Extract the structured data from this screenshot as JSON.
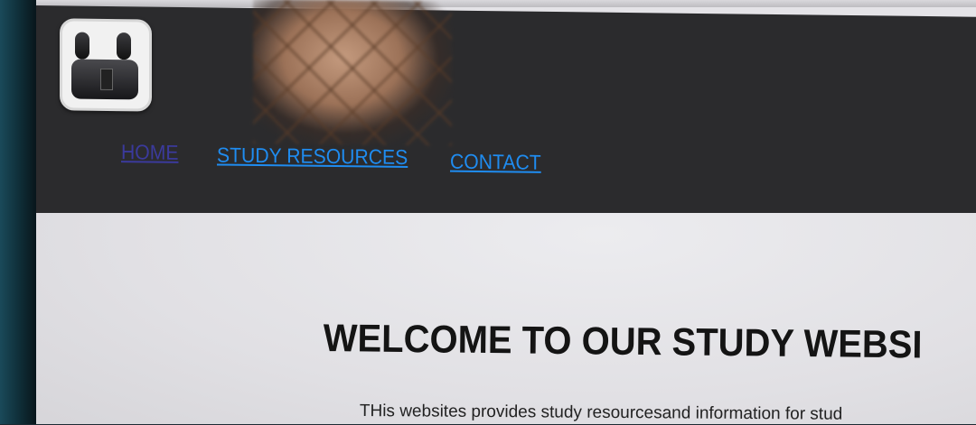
{
  "logo": {
    "icon": "earbuds-icon"
  },
  "nav": {
    "home": "HOME",
    "study_resources": "STUDY RESOURCES",
    "contact": "CONTACT"
  },
  "main": {
    "heading": "WELCOME TO OUR STUDY WEBSI",
    "description": "THis websites provides study resourcesand information for stud"
  },
  "colors": {
    "header_bg": "#2b2b2d",
    "link": "#1f8cf0",
    "link_visited": "#3b3a9c",
    "content_bg": "#e4e3e7"
  }
}
